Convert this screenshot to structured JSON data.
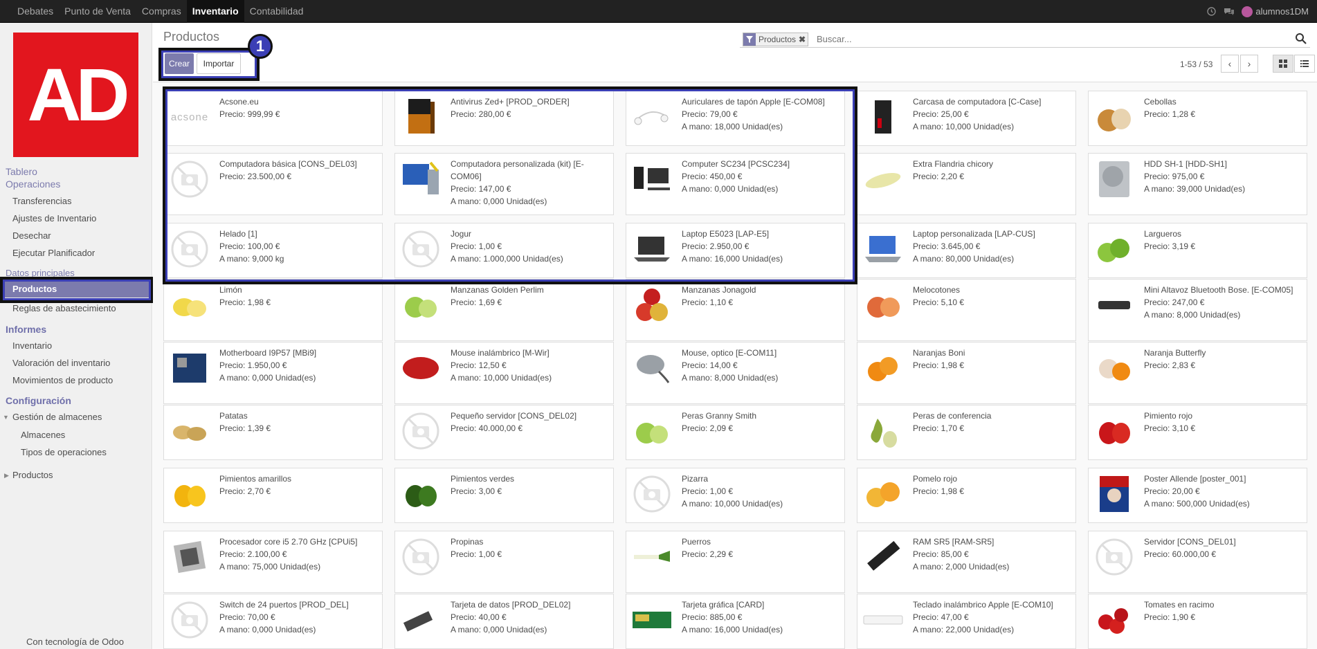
{
  "topnav": [
    "Debates",
    "Punto de Venta",
    "Compras",
    "Inventario",
    "Contabilidad"
  ],
  "topnav_active": "Inventario",
  "user": {
    "name": "alumnos1DM"
  },
  "logo": {
    "text": "AD",
    "color": "#e2161e"
  },
  "sidebar": {
    "tablero": "Tablero",
    "operaciones": "Operaciones",
    "op_items": [
      "Transferencias",
      "Ajustes de Inventario",
      "Desechar",
      "Ejecutar Planificador"
    ],
    "datos": "Datos principales",
    "productos": "Productos",
    "reglas": "Reglas de abastecimiento",
    "informes": "Informes",
    "inf_items": [
      "Inventario",
      "Valoración del inventario",
      "Movimientos de producto"
    ],
    "configuracion": "Configuración",
    "gestion": "Gestión de almacenes",
    "gestion_items": [
      "Almacenes",
      "Tipos de operaciones"
    ],
    "productos2": "Productos",
    "powered": "Con tecnología de Odoo"
  },
  "control": {
    "title": "Productos",
    "crear": "Crear",
    "importar": "Importar",
    "badge": "1",
    "facet": "Productos",
    "search_placeholder": "Buscar...",
    "pager": "1-53 / 53"
  },
  "accent": "#7c7bad",
  "products": [
    {
      "name": "Acsone.eu",
      "price": "Precio: 999,99 €",
      "stock": "",
      "icon": "acsone-logo"
    },
    {
      "name": "Antivirus Zed+ [PROD_ORDER]",
      "price": "Precio: 280,00 €",
      "stock": "",
      "icon": "software-box"
    },
    {
      "name": "Auriculares de tapón Apple [E-COM08]",
      "price": "Precio: 79,00 €",
      "stock": "A mano: 18,000 Unidad(es)",
      "icon": "earphones"
    },
    {
      "name": "Carcasa de computadora [C-Case]",
      "price": "Precio: 25,00 €",
      "stock": "A mano: 10,000 Unidad(es)",
      "icon": "pc-case"
    },
    {
      "name": "Cebollas",
      "price": "Precio: 1,28 €",
      "stock": "",
      "icon": "onion"
    },
    {
      "name": "Computadora básica [CONS_DEL03]",
      "price": "Precio: 23.500,00 €",
      "stock": "",
      "icon": "no-image"
    },
    {
      "name": "Computadora personalizada (kit) [E-COM06]",
      "price": "Precio: 147,00 €",
      "stock": "A mano: 0,000 Unidad(es)",
      "icon": "computer-kit"
    },
    {
      "name": "Computer SC234 [PCSC234]",
      "price": "Precio: 450,00 €",
      "stock": "A mano: 0,000 Unidad(es)",
      "icon": "desktop"
    },
    {
      "name": "Extra Flandria chicory",
      "price": "Precio: 2,20 €",
      "stock": "",
      "icon": "chicory"
    },
    {
      "name": "HDD SH-1 [HDD-SH1]",
      "price": "Precio: 975,00 €",
      "stock": "A mano: 39,000 Unidad(es)",
      "icon": "hdd"
    },
    {
      "name": "Helado [1]",
      "price": "Precio: 100,00 €",
      "stock": "A mano: 9,000 kg",
      "icon": "no-image"
    },
    {
      "name": "Jogur",
      "price": "Precio: 1,00 €",
      "stock": "A mano: 1.000,000 Unidad(es)",
      "icon": "no-image"
    },
    {
      "name": "Laptop E5023 [LAP-E5]",
      "price": "Precio: 2.950,00 €",
      "stock": "A mano: 16,000 Unidad(es)",
      "icon": "laptop"
    },
    {
      "name": "Laptop personalizada [LAP-CUS]",
      "price": "Precio: 3.645,00 €",
      "stock": "A mano: 80,000 Unidad(es)",
      "icon": "laptop-blue"
    },
    {
      "name": "Largueros",
      "price": "Precio: 3,19 €",
      "stock": "",
      "icon": "lime"
    },
    {
      "name": "Limón",
      "price": "Precio: 1,98 €",
      "stock": "",
      "icon": "lemon"
    },
    {
      "name": "Manzanas Golden Perlim",
      "price": "Precio: 1,69 €",
      "stock": "",
      "icon": "green-apple"
    },
    {
      "name": "Manzanas Jonagold",
      "price": "Precio: 1,10 €",
      "stock": "",
      "icon": "red-apple"
    },
    {
      "name": "Melocotones",
      "price": "Precio: 5,10 €",
      "stock": "",
      "icon": "peach"
    },
    {
      "name": "Mini Altavoz Bluetooth Bose. [E-COM05]",
      "price": "Precio: 247,00 €",
      "stock": "A mano: 8,000 Unidad(es)",
      "icon": "speaker"
    },
    {
      "name": "Motherboard I9P57 [MBi9]",
      "price": "Precio: 1.950,00 €",
      "stock": "A mano: 0,000 Unidad(es)",
      "icon": "motherboard"
    },
    {
      "name": "Mouse inalámbrico [M-Wir]",
      "price": "Precio: 12,50 €",
      "stock": "A mano: 10,000 Unidad(es)",
      "icon": "mouse-red"
    },
    {
      "name": "Mouse, optico [E-COM11]",
      "price": "Precio: 14,00 €",
      "stock": "A mano: 8,000 Unidad(es)",
      "icon": "mouse-grey"
    },
    {
      "name": "Naranjas Boni",
      "price": "Precio: 1,98 €",
      "stock": "",
      "icon": "orange"
    },
    {
      "name": "Naranja Butterfly",
      "price": "Precio: 2,83 €",
      "stock": "",
      "icon": "orange-wrapped"
    },
    {
      "name": "Patatas",
      "price": "Precio: 1,39 €",
      "stock": "",
      "icon": "potato"
    },
    {
      "name": "Pequeño servidor [CONS_DEL02]",
      "price": "Precio: 40.000,00 €",
      "stock": "",
      "icon": "no-image"
    },
    {
      "name": "Peras Granny Smith",
      "price": "Precio: 2,09 €",
      "stock": "",
      "icon": "green-apple"
    },
    {
      "name": "Peras de conferencia",
      "price": "Precio: 1,70 €",
      "stock": "",
      "icon": "pear"
    },
    {
      "name": "Pimiento rojo",
      "price": "Precio: 3,10 €",
      "stock": "",
      "icon": "red-pepper"
    },
    {
      "name": "Pimientos amarillos",
      "price": "Precio: 2,70 €",
      "stock": "",
      "icon": "yellow-pepper"
    },
    {
      "name": "Pimientos verdes",
      "price": "Precio: 3,00 €",
      "stock": "",
      "icon": "green-pepper"
    },
    {
      "name": "Pizarra",
      "price": "Precio: 1,00 €",
      "stock": "A mano: 10,000 Unidad(es)",
      "icon": "no-image"
    },
    {
      "name": "Pomelo rojo",
      "price": "Precio: 1,98 €",
      "stock": "",
      "icon": "grapefruit"
    },
    {
      "name": "Poster Allende [poster_001]",
      "price": "Precio: 20,00 €",
      "stock": "A mano: 500,000 Unidad(es)",
      "icon": "poster"
    },
    {
      "name": "Procesador core i5 2.70 GHz [CPUi5]",
      "price": "Precio: 2.100,00 €",
      "stock": "A mano: 75,000 Unidad(es)",
      "icon": "cpu"
    },
    {
      "name": "Propinas",
      "price": "Precio: 1,00 €",
      "stock": "",
      "icon": "no-image"
    },
    {
      "name": "Puerros",
      "price": "Precio: 2,29 €",
      "stock": "",
      "icon": "leek"
    },
    {
      "name": "RAM SR5 [RAM-SR5]",
      "price": "Precio: 85,00 €",
      "stock": "A mano: 2,000 Unidad(es)",
      "icon": "ram"
    },
    {
      "name": "Servidor [CONS_DEL01]",
      "price": "Precio: 60.000,00 €",
      "stock": "",
      "icon": "no-image"
    },
    {
      "name": "Switch de 24 puertos [PROD_DEL]",
      "price": "Precio: 70,00 €",
      "stock": "A mano: 0,000 Unidad(es)",
      "icon": "no-image"
    },
    {
      "name": "Tarjeta de datos [PROD_DEL02]",
      "price": "Precio: 40,00 €",
      "stock": "A mano: 0,000 Unidad(es)",
      "icon": "usb-stick"
    },
    {
      "name": "Tarjeta gráfica [CARD]",
      "price": "Precio: 885,00 €",
      "stock": "A mano: 16,000 Unidad(es)",
      "icon": "graphics-card"
    },
    {
      "name": "Teclado inalámbrico Apple [E-COM10]",
      "price": "Precio: 47,00 €",
      "stock": "A mano: 22,000 Unidad(es)",
      "icon": "keyboard"
    },
    {
      "name": "Tomates en racimo",
      "price": "Precio: 1,90 €",
      "stock": "",
      "icon": "tomato"
    }
  ]
}
